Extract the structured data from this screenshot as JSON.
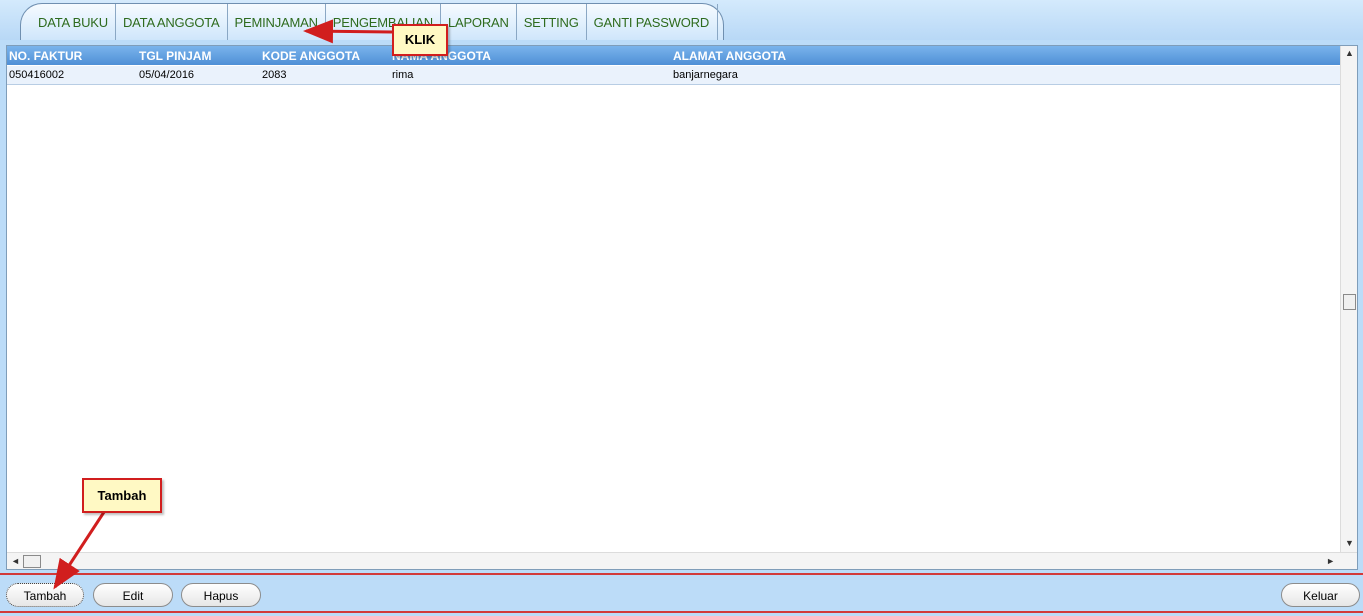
{
  "tabs": [
    {
      "label": "DATA BUKU"
    },
    {
      "label": "DATA ANGGOTA"
    },
    {
      "label": "PEMINJAMAN"
    },
    {
      "label": "PENGEMBALIAN"
    },
    {
      "label": "LAPORAN"
    },
    {
      "label": "SETTING"
    },
    {
      "label": "GANTI PASSWORD"
    }
  ],
  "grid": {
    "columns": [
      "NO. FAKTUR",
      "TGL PINJAM",
      "KODE ANGGOTA",
      "NAMA ANGGOTA",
      "ALAMAT ANGGOTA"
    ],
    "rows": [
      [
        "050416002",
        "05/04/2016",
        "2083",
        "rima",
        "banjarnegara"
      ]
    ]
  },
  "buttons": {
    "tambah": "Tambah",
    "edit": "Edit",
    "hapus": "Hapus",
    "keluar": "Keluar"
  },
  "callouts": {
    "klik": "KLIK",
    "tambah": "Tambah"
  },
  "colors": {
    "accent_red": "#d11e1e",
    "header_blue": "#4f8fd6",
    "tab_text_green": "#2e6b1e"
  }
}
